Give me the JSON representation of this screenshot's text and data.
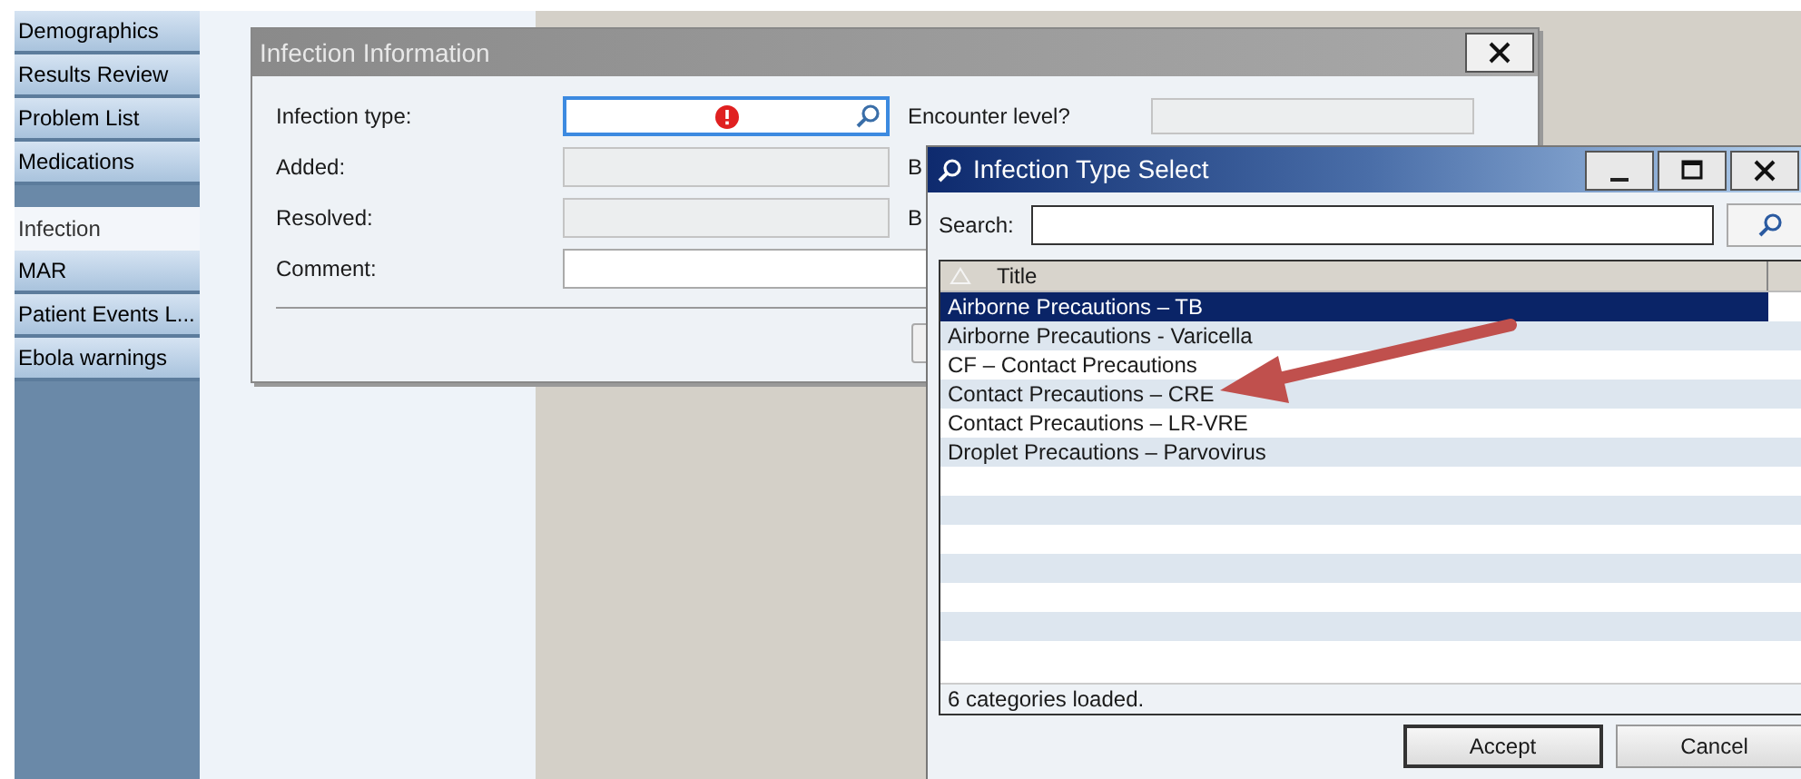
{
  "sidebar": {
    "groups": [
      {
        "items": [
          {
            "label": "Demographics",
            "selected": false
          },
          {
            "label": "Results Review",
            "selected": false
          },
          {
            "label": "Problem List",
            "selected": false
          },
          {
            "label": "Medications",
            "selected": false
          }
        ]
      },
      {
        "items": [
          {
            "label": "Infection",
            "selected": true
          },
          {
            "label": "MAR",
            "selected": false
          },
          {
            "label": "Patient Events L...",
            "selected": false
          },
          {
            "label": "Ebola warnings",
            "selected": false
          }
        ]
      }
    ]
  },
  "infection_dialog": {
    "title": "Infection Information",
    "fields": [
      {
        "label": "Infection type:",
        "kind": "lookup",
        "error": true,
        "disabled": false,
        "side_label": "Encounter level?"
      },
      {
        "label": "Added:",
        "kind": "text",
        "disabled": true,
        "side_label": "B"
      },
      {
        "label": "Resolved:",
        "kind": "text",
        "disabled": true,
        "side_label": "B"
      },
      {
        "label": "Comment:",
        "kind": "text",
        "disabled": false
      }
    ]
  },
  "select_dialog": {
    "title": "Infection Type Select",
    "search": {
      "label": "Search:"
    },
    "table": {
      "columns": [
        "Title"
      ],
      "rows": [
        {
          "title": "Airborne Precautions – TB",
          "selected": true
        },
        {
          "title": "Airborne Precautions - Varicella",
          "selected": false
        },
        {
          "title": "CF – Contact Precautions",
          "selected": false
        },
        {
          "title": "Contact Precautions – CRE",
          "selected": false
        },
        {
          "title": "Contact Precautions – LR-VRE",
          "selected": false
        },
        {
          "title": "Droplet Precautions – Parvovirus",
          "selected": false
        }
      ]
    },
    "status": "6 categories loaded.",
    "buttons": [
      {
        "label": "Accept",
        "default": true
      },
      {
        "label": "Cancel",
        "default": false
      }
    ]
  }
}
